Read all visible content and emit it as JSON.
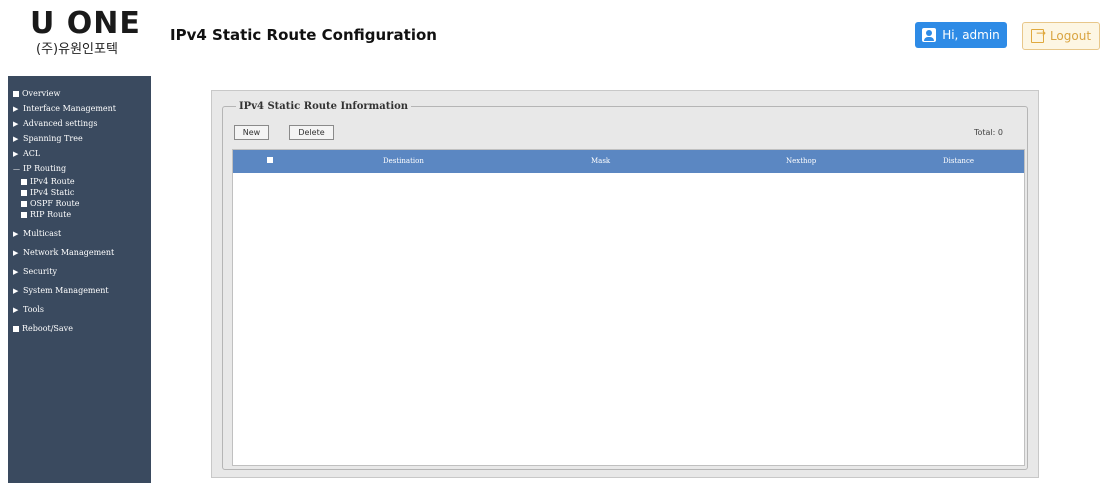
{
  "header": {
    "logo_main": "U ONE",
    "logo_sub": "(주)유원인포텍",
    "title": "IPv4 Static Route Configuration",
    "user_label": "Hi, admin",
    "logout_label": "Logout"
  },
  "sidebar": {
    "items": [
      {
        "marker": "square",
        "label": "Overview"
      },
      {
        "marker": "arrow",
        "label": "Interface Management"
      },
      {
        "marker": "arrow",
        "label": "Advanced settings"
      },
      {
        "marker": "arrow",
        "label": "Spanning Tree"
      },
      {
        "marker": "arrow",
        "label": "ACL"
      },
      {
        "marker": "dash",
        "label": "IP Routing"
      },
      {
        "marker": "square",
        "label": "IPv4 Route",
        "sub": true
      },
      {
        "marker": "square",
        "label": "IPv4 Static",
        "sub": true
      },
      {
        "marker": "square",
        "label": "OSPF Route",
        "sub": true
      },
      {
        "marker": "square",
        "label": "RIP Route",
        "sub": true
      },
      {
        "marker": "arrow",
        "label": "Multicast"
      },
      {
        "marker": "arrow",
        "label": "Network Management"
      },
      {
        "marker": "arrow",
        "label": "Security"
      },
      {
        "marker": "arrow",
        "label": "System Management"
      },
      {
        "marker": "arrow",
        "label": "Tools"
      },
      {
        "marker": "square",
        "label": "Reboot/Save"
      }
    ]
  },
  "panel": {
    "legend": "IPv4 Static Route Information",
    "new_label": "New",
    "delete_label": "Delete",
    "total_label": "Total: 0",
    "columns": [
      "Destination",
      "Mask",
      "Nexthop",
      "Distance"
    ],
    "rows": []
  },
  "colors": {
    "sidebar_bg": "#3a4a5f",
    "table_header_bg": "#5b87c2",
    "user_button_bg": "#2e8be6",
    "logout_accent": "#d9a441"
  }
}
